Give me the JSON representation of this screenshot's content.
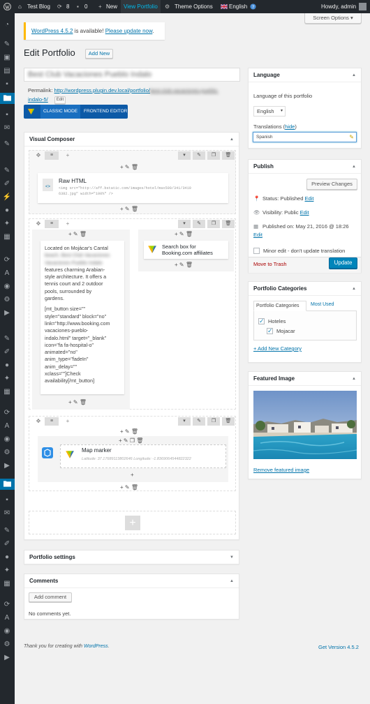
{
  "adminbar": {
    "site": "Test Blog",
    "updates": "8",
    "comments": "0",
    "new": "New",
    "view": "View Portfolio",
    "theme": "Theme Options",
    "lang": "English",
    "howdy": "Howdy, admin"
  },
  "notice": {
    "link1": "WordPress 4.5.2",
    "text": "is available!",
    "link2": "Please update now",
    "end": "."
  },
  "screen_options": "Screen Options",
  "page": {
    "title": "Edit Portfolio",
    "add_new": "Add New"
  },
  "post": {
    "title": "Best Club Vacaciones Pueblo Indalo",
    "permalink_label": "Permalink:",
    "permalink_url": "http://wordpress.plugin.dev.local/portfolio/",
    "permalink_url_blur": "best-club-vacaciones-pueblo-",
    "permalink_url2": "indalo-5/",
    "edit": "Edit",
    "classic": "CLASSIC MODE",
    "frontend": "FRONTEND EDITOR"
  },
  "vc": {
    "title": "Visual Composer",
    "raw_html_title": "Raw HTML",
    "raw_html_code_1": "<img src=\"http://aff.bstatic.com/images/hotel/max500/341/3419",
    "raw_html_code_2": "6382.jpg\" width=\"100%\" />",
    "text_block": [
      "Located on Mojácar's Cantal",
      "beach, Best Club Vacaciones",
      "Vacaciones Pueblo Indalo",
      "features charming Arabian-",
      "style architecture. It offers a",
      "tennis court and 2 outdoor",
      "pools, surrounded by",
      "gardens."
    ],
    "shortcode": [
      "[mt_button size=\"\"",
      "style=\"standard\" block=\"no\"",
      "link=\"http://www.booking.com",
      "vacaciones-pueblo-",
      "indalo.html\" target=\"_blank\"",
      "icon=\"fa fa-hospital-o\"",
      "animated=\"no\"",
      "anim_type=\"fadeIn\"",
      "anim_delay=\"\"",
      "xclass=\"\"]Check",
      "availability[/mt_button]"
    ],
    "search_title_1": "Search box for",
    "search_title_2": "Booking.com affiliates",
    "map_title": "Map marker",
    "map_coords": "Latitude: 37.17689113802646 Longitude: -1.8369064544822322"
  },
  "portfolio_settings": "Portfolio settings",
  "comments": {
    "title": "Comments",
    "add": "Add comment",
    "none": "No comments yet."
  },
  "language": {
    "title": "Language",
    "label": "Language of this portfolio",
    "selected": "English",
    "translations": "Translations (",
    "hide": "hide",
    "close": ")",
    "spanish": "Spanish"
  },
  "publish": {
    "title": "Publish",
    "preview": "Preview Changes",
    "status_label": "Status:",
    "status": "Published",
    "status_edit": "Edit",
    "vis_label": "Visibility:",
    "vis": "Public",
    "vis_edit": "Edit",
    "published_label": "Published on:",
    "published": "May 21, 2016 @ 18:26",
    "pub_edit": "Edit",
    "minor": "Minor edit - don't update translation",
    "trash": "Move to Trash",
    "update": "Update"
  },
  "categories": {
    "title": "Portfolio Categories",
    "tab_all": "Portfolio Categories",
    "tab_used": "Most Used",
    "hoteles": "Hoteles",
    "mojacar": "Mojacar",
    "add_new": "+ Add New Category"
  },
  "featured": {
    "title": "Featured Image",
    "remove": "Remove featured image"
  },
  "footer": {
    "thanks": "Thank you for creating with",
    "wp": "WordPress",
    "dot": ".",
    "version": "Get Version 4.5.2"
  },
  "colors": {
    "accent": "#0073aa",
    "adminbar": "#23282d",
    "notice": "#ffb900",
    "vc_blue": "#0d5aa7"
  }
}
